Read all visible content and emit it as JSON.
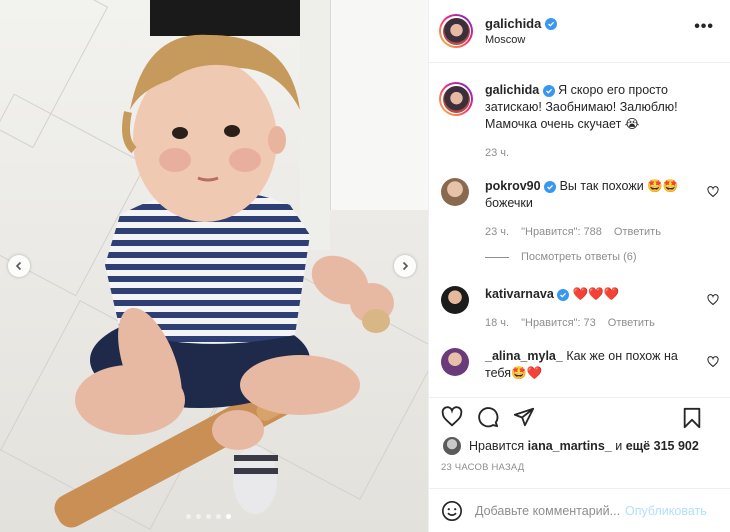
{
  "post": {
    "author": "galichida",
    "location": "Moscow",
    "verified": true
  },
  "caption": {
    "username": "galichida",
    "text": "Я скоро его просто затискаю! Заобнимаю! Залюблю! Мамочка очень скучает 😭",
    "time": "23 ч."
  },
  "comments": [
    {
      "username": "pokrov90",
      "verified": true,
      "text": "Вы так похожи 🤩🤩божечки",
      "time": "23 ч.",
      "likes": "\"Нравится\": 788",
      "reply": "Ответить",
      "view_replies": "Посмотреть ответы (6)"
    },
    {
      "username": "kativarnava",
      "verified": true,
      "text": "❤️❤️❤️",
      "time": "18 ч.",
      "likes": "\"Нравится\": 73",
      "reply": "Ответить"
    },
    {
      "username": "_alina_myla_",
      "verified": false,
      "text": "Как же он похож на тебя🤩❤️"
    }
  ],
  "likes": {
    "prefix": "Нравится",
    "user": "iana_martins_",
    "middle": "и",
    "others": "ещё 315 902"
  },
  "timestamp": "23 ЧАСОВ НАЗАД",
  "add_comment": {
    "placeholder": "Добавьте комментарий...",
    "publish": "Опубликовать"
  },
  "carousel": {
    "count": 5,
    "active_index": 4
  },
  "icons": {
    "header": [
      "verified-icon",
      "more-icon"
    ],
    "actions": [
      "heart-icon",
      "comment-icon",
      "share-icon",
      "bookmark-icon"
    ],
    "carousel": [
      "chevron-left-icon",
      "chevron-right-icon"
    ]
  },
  "colors": {
    "verified": "#3897f0",
    "link_disabled": "#b2dffc",
    "muted": "#8e8e8e",
    "text": "#262626",
    "heart_emoji": "#e0245e"
  }
}
